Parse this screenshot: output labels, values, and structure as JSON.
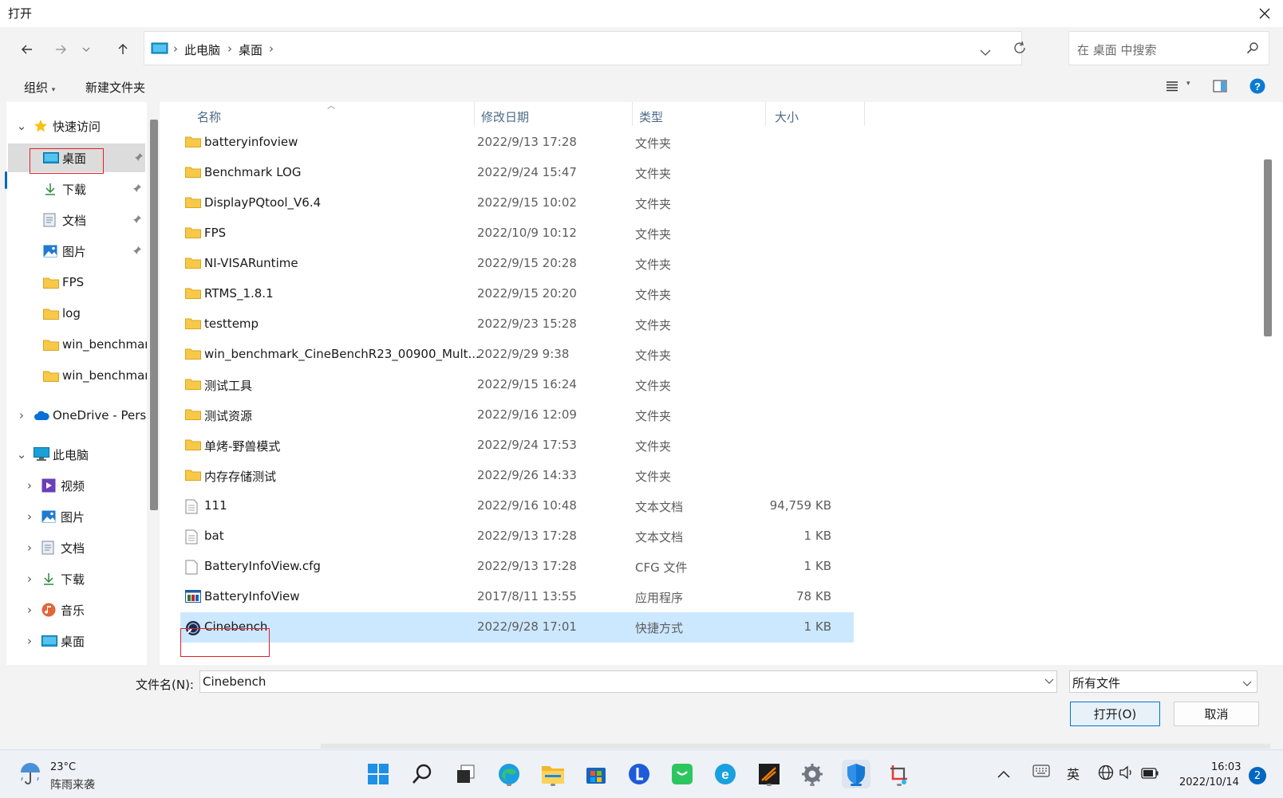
{
  "window": {
    "title": "打开",
    "close_icon": "close-icon"
  },
  "address": {
    "segments": [
      "此电脑",
      "桌面"
    ]
  },
  "search": {
    "placeholder": "在 桌面 中搜索"
  },
  "toolbar": {
    "organize": "组织",
    "new_folder": "新建文件夹"
  },
  "sidebar": {
    "quick_access": "快速访问",
    "quick_items": [
      {
        "label": "桌面",
        "icon": "desktop-icon",
        "pinned": true
      },
      {
        "label": "下载",
        "icon": "download-icon",
        "pinned": true
      },
      {
        "label": "文档",
        "icon": "document-icon",
        "pinned": true
      },
      {
        "label": "图片",
        "icon": "pictures-icon",
        "pinned": true
      },
      {
        "label": "FPS",
        "icon": "folder-icon"
      },
      {
        "label": "log",
        "icon": "folder-icon"
      },
      {
        "label": "win_benchmar",
        "icon": "folder-icon"
      },
      {
        "label": "win_benchmar",
        "icon": "folder-icon"
      }
    ],
    "onedrive": "OneDrive - Pers",
    "this_pc": "此电脑",
    "pc_items": [
      {
        "label": "视频",
        "icon": "video-icon"
      },
      {
        "label": "图片",
        "icon": "pictures-icon"
      },
      {
        "label": "文档",
        "icon": "document-icon"
      },
      {
        "label": "下载",
        "icon": "download-icon"
      },
      {
        "label": "音乐",
        "icon": "music-icon"
      },
      {
        "label": "桌面",
        "icon": "desktop-icon"
      }
    ]
  },
  "columns": {
    "name": "名称",
    "date": "修改日期",
    "type": "类型",
    "size": "大小"
  },
  "files": [
    {
      "name": "batteryinfoview",
      "date": "2022/9/13 17:28",
      "type": "文件夹",
      "size": "",
      "icon": "folder-icon"
    },
    {
      "name": "Benchmark LOG",
      "date": "2022/9/24 15:47",
      "type": "文件夹",
      "size": "",
      "icon": "folder-icon"
    },
    {
      "name": "DisplayPQtool_V6.4",
      "date": "2022/9/15 10:02",
      "type": "文件夹",
      "size": "",
      "icon": "folder-icon"
    },
    {
      "name": "FPS",
      "date": "2022/10/9 10:12",
      "type": "文件夹",
      "size": "",
      "icon": "folder-icon"
    },
    {
      "name": "NI-VISARuntime",
      "date": "2022/9/15 20:28",
      "type": "文件夹",
      "size": "",
      "icon": "folder-icon"
    },
    {
      "name": "RTMS_1.8.1",
      "date": "2022/9/15 20:20",
      "type": "文件夹",
      "size": "",
      "icon": "folder-icon"
    },
    {
      "name": "testtemp",
      "date": "2022/9/23 15:28",
      "type": "文件夹",
      "size": "",
      "icon": "folder-icon"
    },
    {
      "name": "win_benchmark_CineBenchR23_00900_Mult...",
      "date": "2022/9/29 9:38",
      "type": "文件夹",
      "size": "",
      "icon": "folder-icon"
    },
    {
      "name": "测试工具",
      "date": "2022/9/15 16:24",
      "type": "文件夹",
      "size": "",
      "icon": "folder-icon"
    },
    {
      "name": "测试资源",
      "date": "2022/9/16 12:09",
      "type": "文件夹",
      "size": "",
      "icon": "folder-icon"
    },
    {
      "name": "单烤-野兽模式",
      "date": "2022/9/24 17:53",
      "type": "文件夹",
      "size": "",
      "icon": "folder-icon"
    },
    {
      "name": "内存存储测试",
      "date": "2022/9/26 14:33",
      "type": "文件夹",
      "size": "",
      "icon": "folder-icon"
    },
    {
      "name": "111",
      "date": "2022/9/16 10:48",
      "type": "文本文档",
      "size": "94,759 KB",
      "icon": "text-file-icon"
    },
    {
      "name": "bat",
      "date": "2022/9/13 17:28",
      "type": "文本文档",
      "size": "1 KB",
      "icon": "text-file-icon"
    },
    {
      "name": "BatteryInfoView.cfg",
      "date": "2022/9/13 17:28",
      "type": "CFG 文件",
      "size": "1 KB",
      "icon": "file-icon"
    },
    {
      "name": "BatteryInfoView",
      "date": "2017/8/11 13:55",
      "type": "应用程序",
      "size": "78 KB",
      "icon": "app-icon"
    },
    {
      "name": "Cinebench",
      "date": "2022/9/28 17:01",
      "type": "快捷方式",
      "size": "1 KB",
      "icon": "cinebench-icon",
      "selected": true
    }
  ],
  "bottom": {
    "filename_label": "文件名(N):",
    "filename_value": "Cinebench",
    "filter": "所有文件",
    "open": "打开(O)",
    "cancel": "取消"
  },
  "taskbar": {
    "weather_temp": "23°C",
    "weather_desc": "阵雨来袭",
    "ime": "英",
    "time": "16:03",
    "date": "2022/10/14",
    "notifications": "2"
  },
  "colors": {
    "accent": "#0067c0",
    "selection": "#cce8ff",
    "annotation": "#e0202a",
    "folder": "#f8c948"
  }
}
